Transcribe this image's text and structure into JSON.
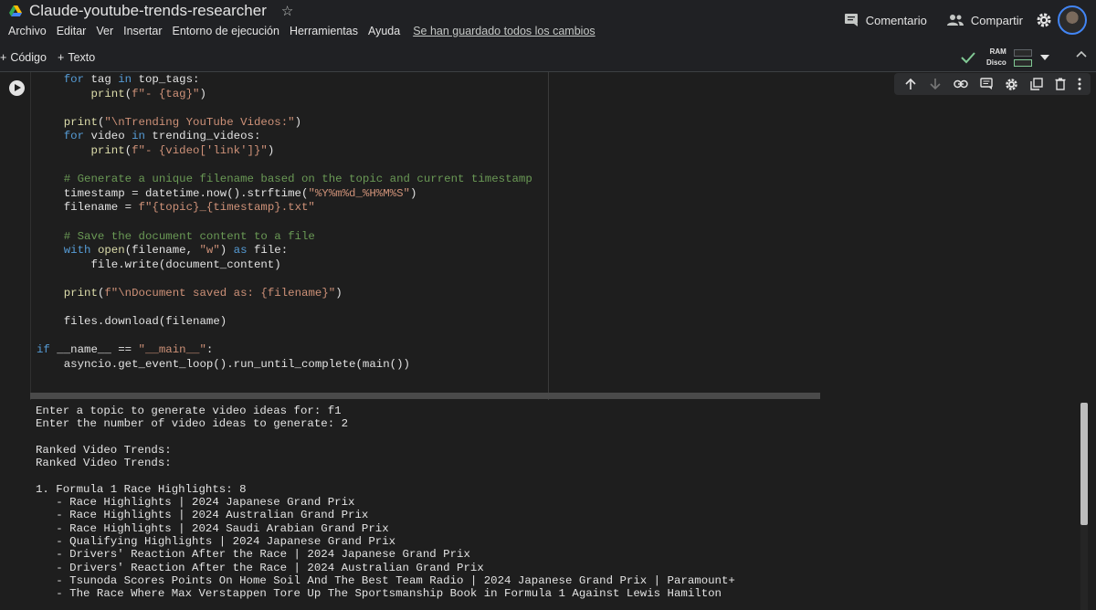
{
  "header": {
    "title": "Claude-youtube-trends-researcher",
    "menu": [
      "Archivo",
      "Editar",
      "Ver",
      "Insertar",
      "Entorno de ejecución",
      "Herramientas",
      "Ayuda"
    ],
    "saved_status": "Se han guardado todos los cambios",
    "comment_label": "Comentario",
    "share_label": "Compartir"
  },
  "toolbar": {
    "code_label": "Código",
    "text_label": "Texto",
    "ram_label": "RAM",
    "disk_label": "Disco"
  },
  "code_lines": [
    {
      "segs": [
        {
          "t": "    ",
          "c": ""
        },
        {
          "t": "for",
          "c": "kw"
        },
        {
          "t": " tag ",
          "c": ""
        },
        {
          "t": "in",
          "c": "kw"
        },
        {
          "t": " top_tags:",
          "c": ""
        }
      ]
    },
    {
      "segs": [
        {
          "t": "        ",
          "c": ""
        },
        {
          "t": "print",
          "c": "fn"
        },
        {
          "t": "(",
          "c": ""
        },
        {
          "t": "f\"- {tag}\"",
          "c": "str"
        },
        {
          "t": ")",
          "c": ""
        }
      ]
    },
    {
      "segs": [
        {
          "t": "",
          "c": ""
        }
      ]
    },
    {
      "segs": [
        {
          "t": "    ",
          "c": ""
        },
        {
          "t": "print",
          "c": "fn"
        },
        {
          "t": "(",
          "c": ""
        },
        {
          "t": "\"\\nTrending YouTube Videos:\"",
          "c": "str"
        },
        {
          "t": ")",
          "c": ""
        }
      ]
    },
    {
      "segs": [
        {
          "t": "    ",
          "c": ""
        },
        {
          "t": "for",
          "c": "kw"
        },
        {
          "t": " video ",
          "c": ""
        },
        {
          "t": "in",
          "c": "kw"
        },
        {
          "t": " trending_videos:",
          "c": ""
        }
      ]
    },
    {
      "segs": [
        {
          "t": "        ",
          "c": ""
        },
        {
          "t": "print",
          "c": "fn"
        },
        {
          "t": "(",
          "c": ""
        },
        {
          "t": "f\"- {video['link']}\"",
          "c": "str"
        },
        {
          "t": ")",
          "c": ""
        }
      ]
    },
    {
      "segs": [
        {
          "t": "",
          "c": ""
        }
      ]
    },
    {
      "segs": [
        {
          "t": "    ",
          "c": ""
        },
        {
          "t": "# Generate a unique filename based on the topic and current timestamp",
          "c": "cm"
        }
      ]
    },
    {
      "segs": [
        {
          "t": "    timestamp = datetime.now().strftime(",
          "c": ""
        },
        {
          "t": "\"%Y%m%d_%H%M%S\"",
          "c": "str"
        },
        {
          "t": ")",
          "c": ""
        }
      ]
    },
    {
      "segs": [
        {
          "t": "    filename = ",
          "c": ""
        },
        {
          "t": "f\"{topic}_{timestamp}.txt\"",
          "c": "str"
        }
      ]
    },
    {
      "segs": [
        {
          "t": "",
          "c": ""
        }
      ]
    },
    {
      "segs": [
        {
          "t": "    ",
          "c": ""
        },
        {
          "t": "# Save the document content to a file",
          "c": "cm"
        }
      ]
    },
    {
      "segs": [
        {
          "t": "    ",
          "c": ""
        },
        {
          "t": "with",
          "c": "kw"
        },
        {
          "t": " ",
          "c": ""
        },
        {
          "t": "open",
          "c": "fn"
        },
        {
          "t": "(filename, ",
          "c": ""
        },
        {
          "t": "\"w\"",
          "c": "str"
        },
        {
          "t": ") ",
          "c": ""
        },
        {
          "t": "as",
          "c": "kw"
        },
        {
          "t": " file:",
          "c": ""
        }
      ]
    },
    {
      "segs": [
        {
          "t": "        file.write(document_content)",
          "c": ""
        }
      ]
    },
    {
      "segs": [
        {
          "t": "",
          "c": ""
        }
      ]
    },
    {
      "segs": [
        {
          "t": "    ",
          "c": ""
        },
        {
          "t": "print",
          "c": "fn"
        },
        {
          "t": "(",
          "c": ""
        },
        {
          "t": "f\"\\nDocument saved as: {filename}\"",
          "c": "str"
        },
        {
          "t": ")",
          "c": ""
        }
      ]
    },
    {
      "segs": [
        {
          "t": "",
          "c": ""
        }
      ]
    },
    {
      "segs": [
        {
          "t": "    files.download(filename)",
          "c": ""
        }
      ]
    },
    {
      "segs": [
        {
          "t": "",
          "c": ""
        }
      ]
    },
    {
      "segs": [
        {
          "t": "if",
          "c": "kw"
        },
        {
          "t": " __name__ == ",
          "c": ""
        },
        {
          "t": "\"__main__\"",
          "c": "str"
        },
        {
          "t": ":",
          "c": ""
        }
      ]
    },
    {
      "segs": [
        {
          "t": "    asyncio.get_event_loop().run_until_complete(main())",
          "c": ""
        }
      ]
    }
  ],
  "output_lines": [
    "Enter a topic to generate video ideas for: f1",
    "Enter the number of video ideas to generate: 2",
    "",
    "Ranked Video Trends:",
    "Ranked Video Trends:",
    "",
    "1. Formula 1 Race Highlights: 8",
    "   - Race Highlights | 2024 Japanese Grand Prix",
    "   - Race Highlights | 2024 Australian Grand Prix",
    "   - Race Highlights | 2024 Saudi Arabian Grand Prix",
    "   - Qualifying Highlights | 2024 Japanese Grand Prix",
    "   - Drivers' Reaction After the Race | 2024 Japanese Grand Prix",
    "   - Drivers' Reaction After the Race | 2024 Australian Grand Prix",
    "   - Tsunoda Scores Points On Home Soil And The Best Team Radio | 2024 Japanese Grand Prix | Paramount+",
    "   - The Race Where Max Verstappen Tore Up The Sportsmanship Book in Formula 1 Against Lewis Hamilton"
  ],
  "icons": {
    "drive": "google-drive-icon",
    "star": "star-icon",
    "comment": "comment-icon",
    "share": "people-icon",
    "settings": "gear-icon",
    "run": "play-icon"
  },
  "colors": {
    "background": "#1e1e1e",
    "header": "#202124",
    "keyword": "#569cd6",
    "function": "#dcdcaa",
    "string": "#ce9178",
    "comment": "#6a9955",
    "check": "#81c995"
  },
  "scroll_position": 0.0
}
